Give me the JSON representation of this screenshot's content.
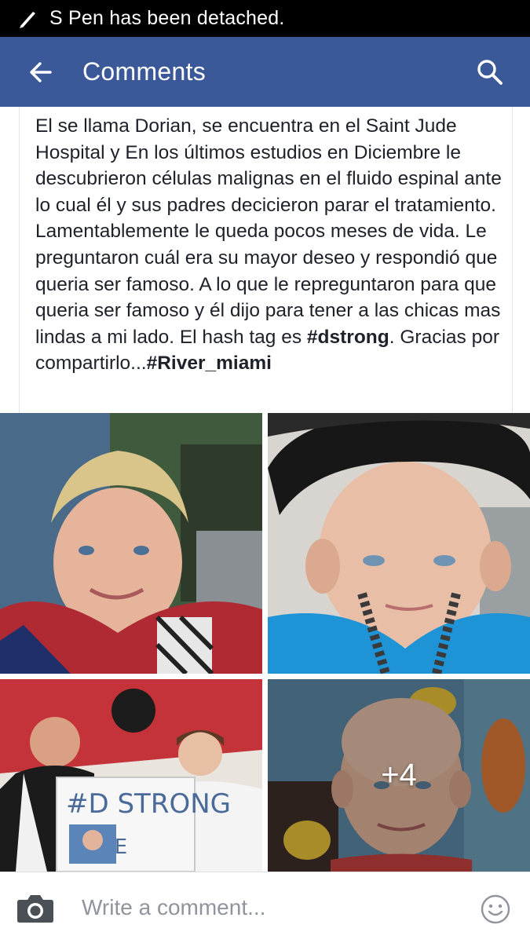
{
  "status_bar": {
    "notification_text": "S Pen has been detached.",
    "icon": "pen-icon"
  },
  "app_bar": {
    "title": "Comments",
    "back_icon": "arrow-left-icon",
    "search_icon": "search-icon",
    "color": "#3b5998"
  },
  "post": {
    "text_segments": [
      "El se llama Dorian, se encuentra en el Saint Jude Hospital y En los últimos estudios en Diciembre le descubrieron células malignas en el fluido espinal ante lo cual él y sus padres decicieron parar el tratamiento. Lamentablemente le queda pocos meses de vida.  Le preguntaron cuál era su mayor deseo y respondió que queria ser famoso. A lo que le repreguntaron para que queria ser famoso y él dijo para tener a las chicas mas lindas a mi lado. El hash tag es ",
      "#dstrong",
      ".  Gracias por compartirlo...",
      "#River_miami"
    ]
  },
  "photos": {
    "more_count": "+4",
    "sign_text": "#D STRONG",
    "sign_text_2": "WE"
  },
  "composer": {
    "placeholder": "Write a comment...",
    "value": "",
    "camera_icon": "camera-icon",
    "emoji_icon": "smiley-icon"
  }
}
